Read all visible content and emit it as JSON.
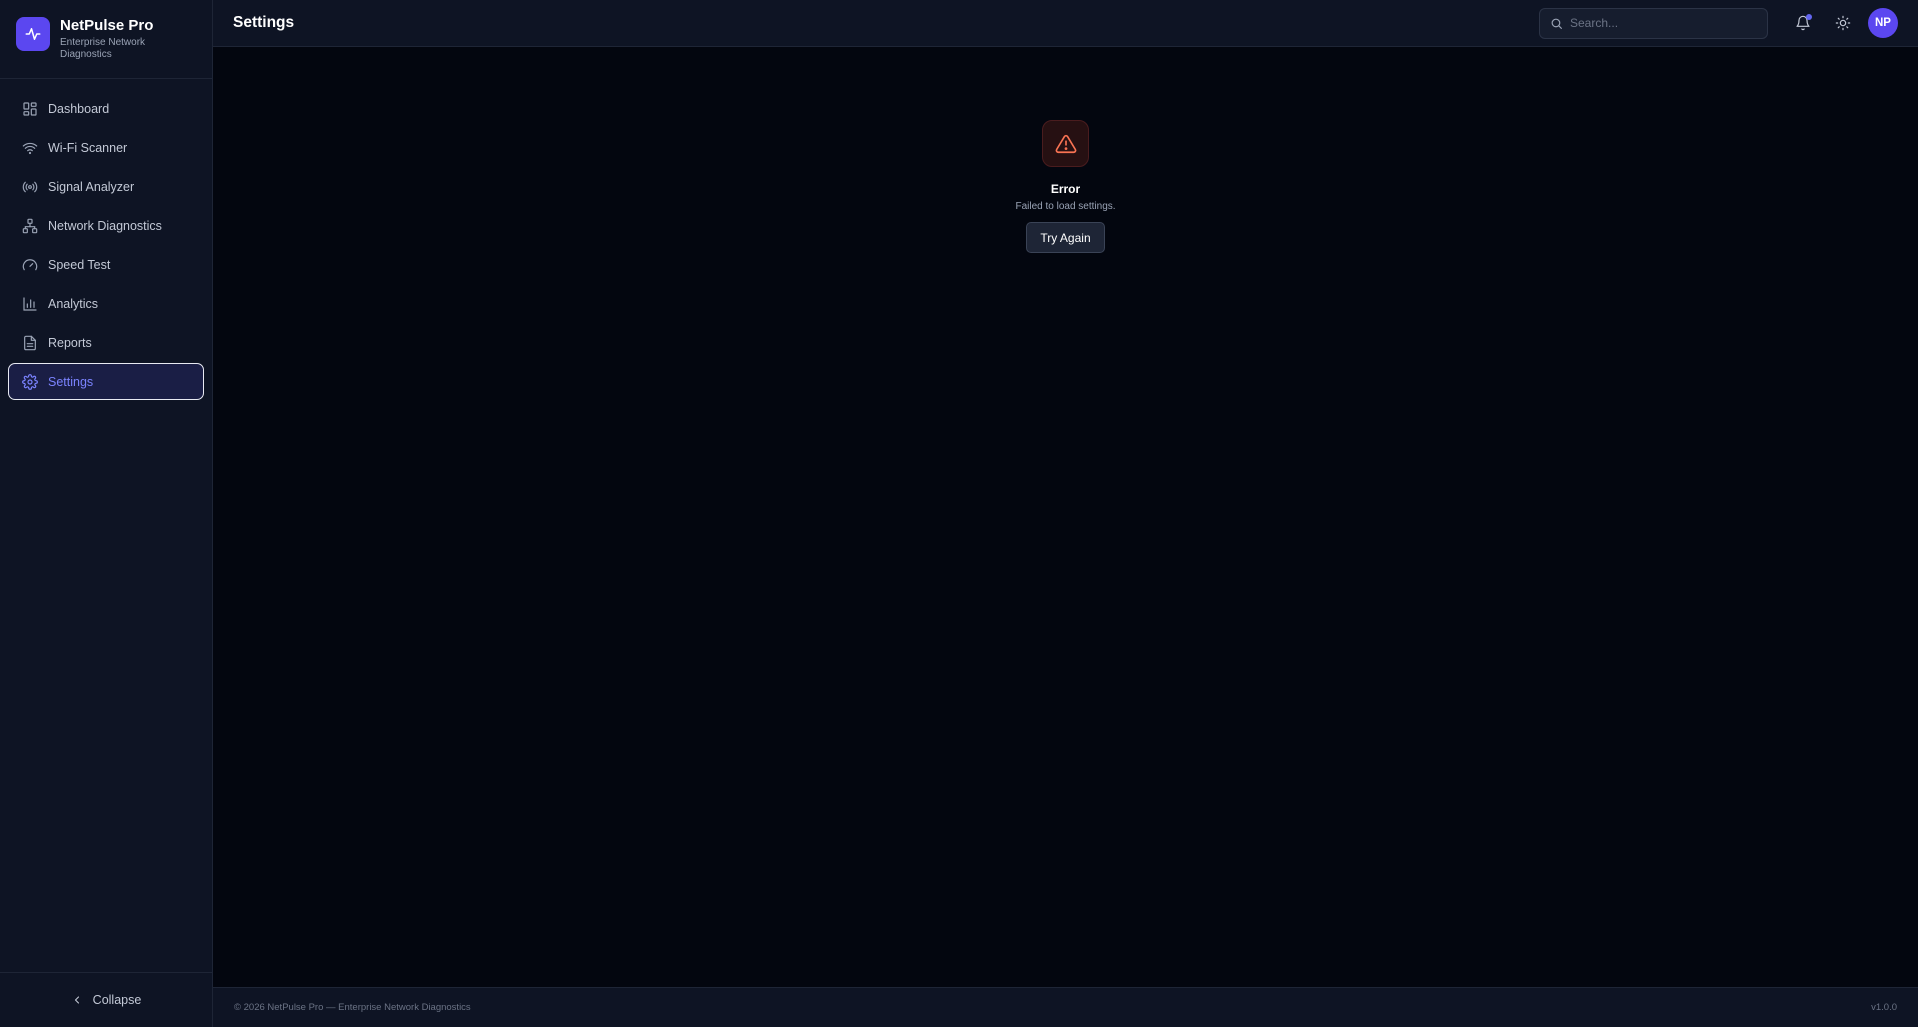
{
  "brand": {
    "name": "NetPulse Pro",
    "subtitle": "Enterprise Network Diagnostics",
    "logo_color": "#5b47f0"
  },
  "sidebar": {
    "items": [
      {
        "label": "Dashboard",
        "icon": "dashboard-icon"
      },
      {
        "label": "Wi-Fi Scanner",
        "icon": "wifi-icon"
      },
      {
        "label": "Signal Analyzer",
        "icon": "signal-icon"
      },
      {
        "label": "Network Diagnostics",
        "icon": "network-icon"
      },
      {
        "label": "Speed Test",
        "icon": "gauge-icon"
      },
      {
        "label": "Analytics",
        "icon": "bar-chart-icon"
      },
      {
        "label": "Reports",
        "icon": "document-icon"
      },
      {
        "label": "Settings",
        "icon": "gear-icon",
        "active": true
      }
    ],
    "collapse_label": "Collapse"
  },
  "header": {
    "title": "Settings",
    "search_placeholder": "Search...",
    "avatar_initials": "NP"
  },
  "error": {
    "title": "Error",
    "message": "Failed to load settings.",
    "button_label": "Try Again"
  },
  "footer": {
    "copyright": "© 2026 NetPulse Pro — Enterprise Network Diagnostics",
    "version": "v1.0.0"
  },
  "colors": {
    "accent": "#6366f1",
    "error": "#f97353",
    "background": "#03060f",
    "panel": "#0e1424"
  }
}
